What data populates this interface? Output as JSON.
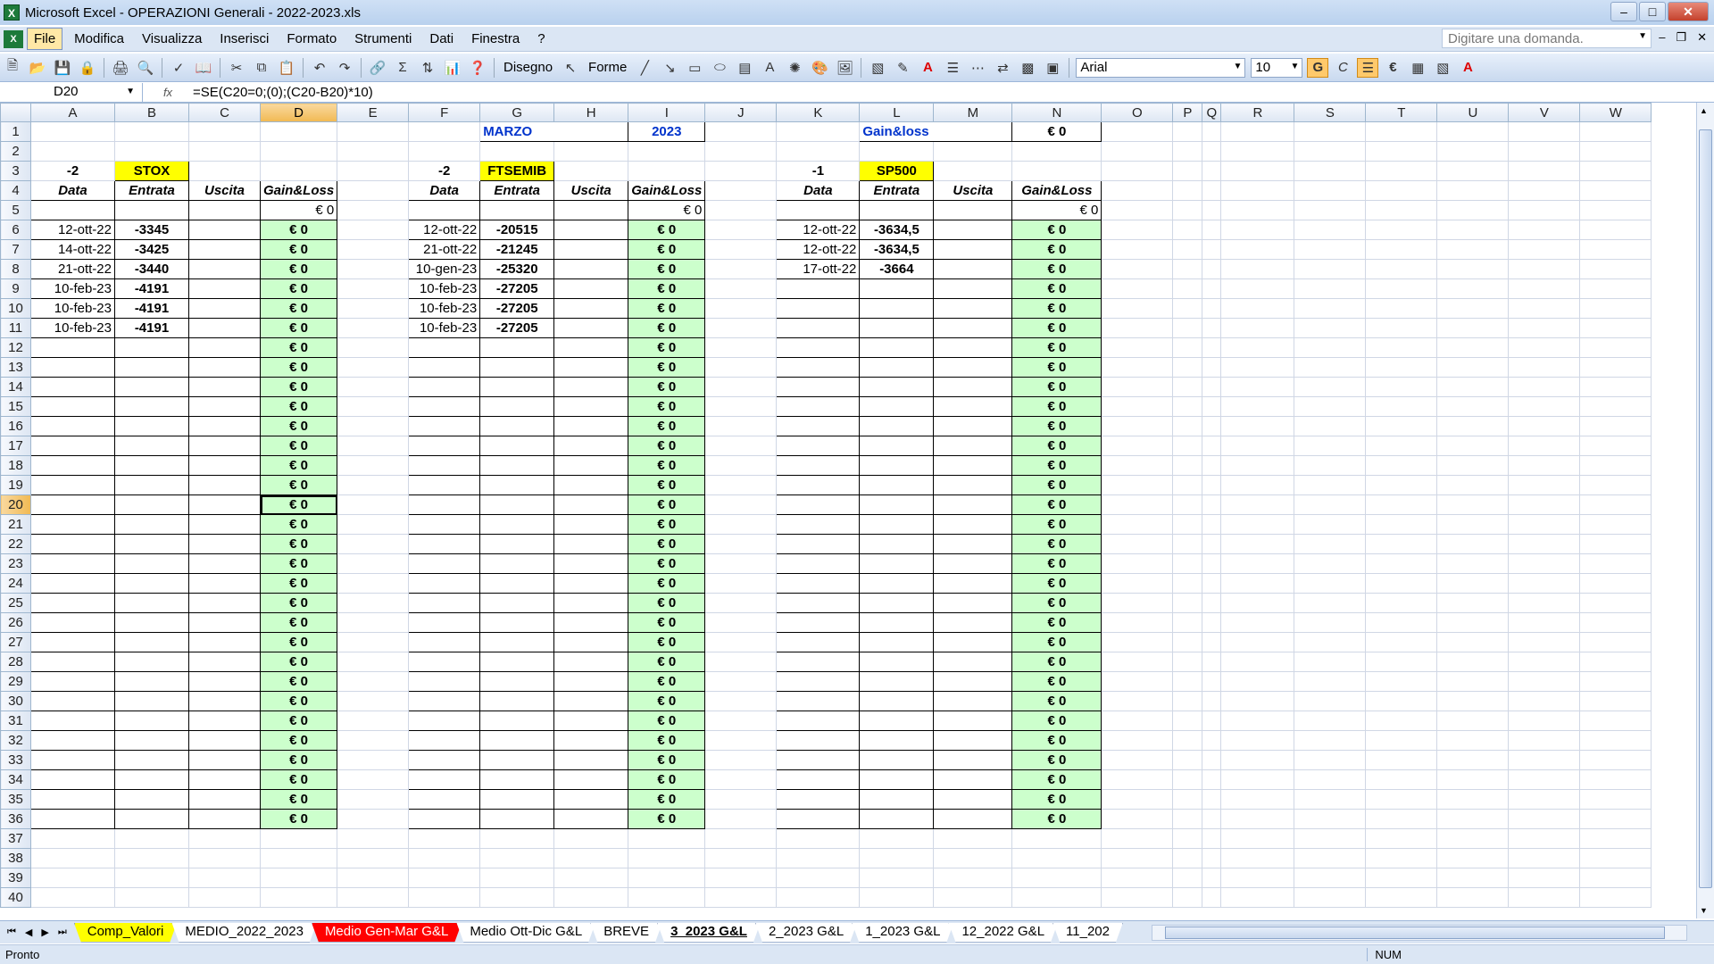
{
  "window": {
    "title": "Microsoft Excel - OPERAZIONI Generali - 2022-2023.xls"
  },
  "menu": [
    "File",
    "Modifica",
    "Visualizza",
    "Inserisci",
    "Formato",
    "Strumenti",
    "Dati",
    "Finestra",
    "?"
  ],
  "ask": {
    "placeholder": "Digitare una domanda."
  },
  "toolbar": {
    "draw_label": "Disegno",
    "shapes_label": "Forme",
    "font": "Arial",
    "size": "10",
    "bold": "G",
    "italic": "C",
    "euro": "€"
  },
  "formula_bar": {
    "cell": "D20",
    "fx": "fx",
    "formula": "=SE(C20=0;(0);(C20-B20)*10)"
  },
  "columns": [
    "A",
    "B",
    "C",
    "D",
    "E",
    "F",
    "G",
    "H",
    "I",
    "J",
    "K",
    "L",
    "M",
    "N",
    "O",
    "P",
    "Q",
    "R",
    "S",
    "T",
    "U",
    "V",
    "W"
  ],
  "header_cells": {
    "month": "MARZO",
    "year": "2023",
    "gl_title": "Gain&loss",
    "gl_total": "€ 0"
  },
  "blocks": [
    {
      "qty": "-2",
      "name": "STOX",
      "headers": [
        "Data",
        "Entrata",
        "Uscita",
        "Gain&Loss"
      ],
      "total": "€ 0",
      "rows": [
        [
          "12-ott-22",
          "-3345"
        ],
        [
          "14-ott-22",
          "-3425"
        ],
        [
          "21-ott-22",
          "-3440"
        ],
        [
          "10-feb-23",
          "-4191"
        ],
        [
          "10-feb-23",
          "-4191"
        ],
        [
          "10-feb-23",
          "-4191"
        ]
      ]
    },
    {
      "qty": "-2",
      "name": "FTSEMIB",
      "headers": [
        "Data",
        "Entrata",
        "Uscita",
        "Gain&Loss"
      ],
      "total": "€ 0",
      "rows": [
        [
          "12-ott-22",
          "-20515"
        ],
        [
          "21-ott-22",
          "-21245"
        ],
        [
          "10-gen-23",
          "-25320"
        ],
        [
          "10-feb-23",
          "-27205"
        ],
        [
          "10-feb-23",
          "-27205"
        ],
        [
          "10-feb-23",
          "-27205"
        ]
      ]
    },
    {
      "qty": "-1",
      "name": "SP500",
      "headers": [
        "Data",
        "Entrata",
        "Uscita",
        "Gain&Loss"
      ],
      "total": "€ 0",
      "rows": [
        [
          "12-ott-22",
          "-3634,5"
        ],
        [
          "12-ott-22",
          "-3634,5"
        ],
        [
          "17-ott-22",
          "-3664"
        ]
      ]
    }
  ],
  "gl_value": "€ 0",
  "sheets": [
    "Comp_Valori",
    "MEDIO_2022_2023",
    "Medio Gen-Mar G&L",
    "Medio Ott-Dic G&L",
    "BREVE",
    "3_2023 G&L",
    "2_2023 G&L",
    "1_2023 G&L",
    "12_2022 G&L",
    "11_202"
  ],
  "tab_colors": {
    "Comp_Valori": "#ffff00",
    "Medio Gen-Mar G&L": "#ff0000"
  },
  "status": {
    "left": "Pronto",
    "num": "NUM"
  }
}
